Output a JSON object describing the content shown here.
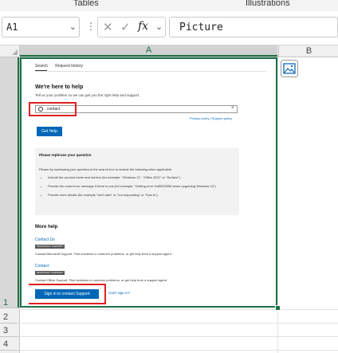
{
  "ribbon": {
    "left_group": "Tables",
    "right_group": "Illustrations"
  },
  "formula_bar": {
    "name_box": "A1",
    "formula": "Picture",
    "fx_label": "fx"
  },
  "columns": [
    "A",
    "B"
  ],
  "rows": [
    "1",
    "2",
    "3",
    "4"
  ],
  "picture": {
    "tabs": [
      "Search",
      "Request history"
    ],
    "heading": "We're here to help",
    "subtext": "Tell us your problem so we can get you the right help and support.",
    "search_value": "contact",
    "privacy_links": "Privacy policy | Support policy",
    "get_help": "Get Help",
    "rephrase_title": "Please rephrase your question",
    "rephrase_text": "Please try rephrasing your question in the search box to include the following when applicable:",
    "rephrase_items": [
      "Include the product name and version (for example: \"Windows 11\", \"Office 2021\" or \"Surface\")",
      "Provide the exact error message if there is one (for example: \"Getting error 0x80200056 when upgrading Windows 10\")",
      "Provide more details (for example \"can't start\" or \"not responding\" or \"how to\")"
    ],
    "more_help": "More help",
    "contact_us": "Contact Us",
    "badge": "MICROSOFT SUPPORT",
    "contact_us_desc": "Contact Microsoft Support. Find solutions to common problems, or get help from a support agent.",
    "contact": "Contact",
    "contact_desc": "Contact Office Support. Find solutions to common problems, or get help from a support agent.",
    "sign_in": "Sign in to contact Support",
    "cant_sign_in": "Can't sign in?"
  }
}
